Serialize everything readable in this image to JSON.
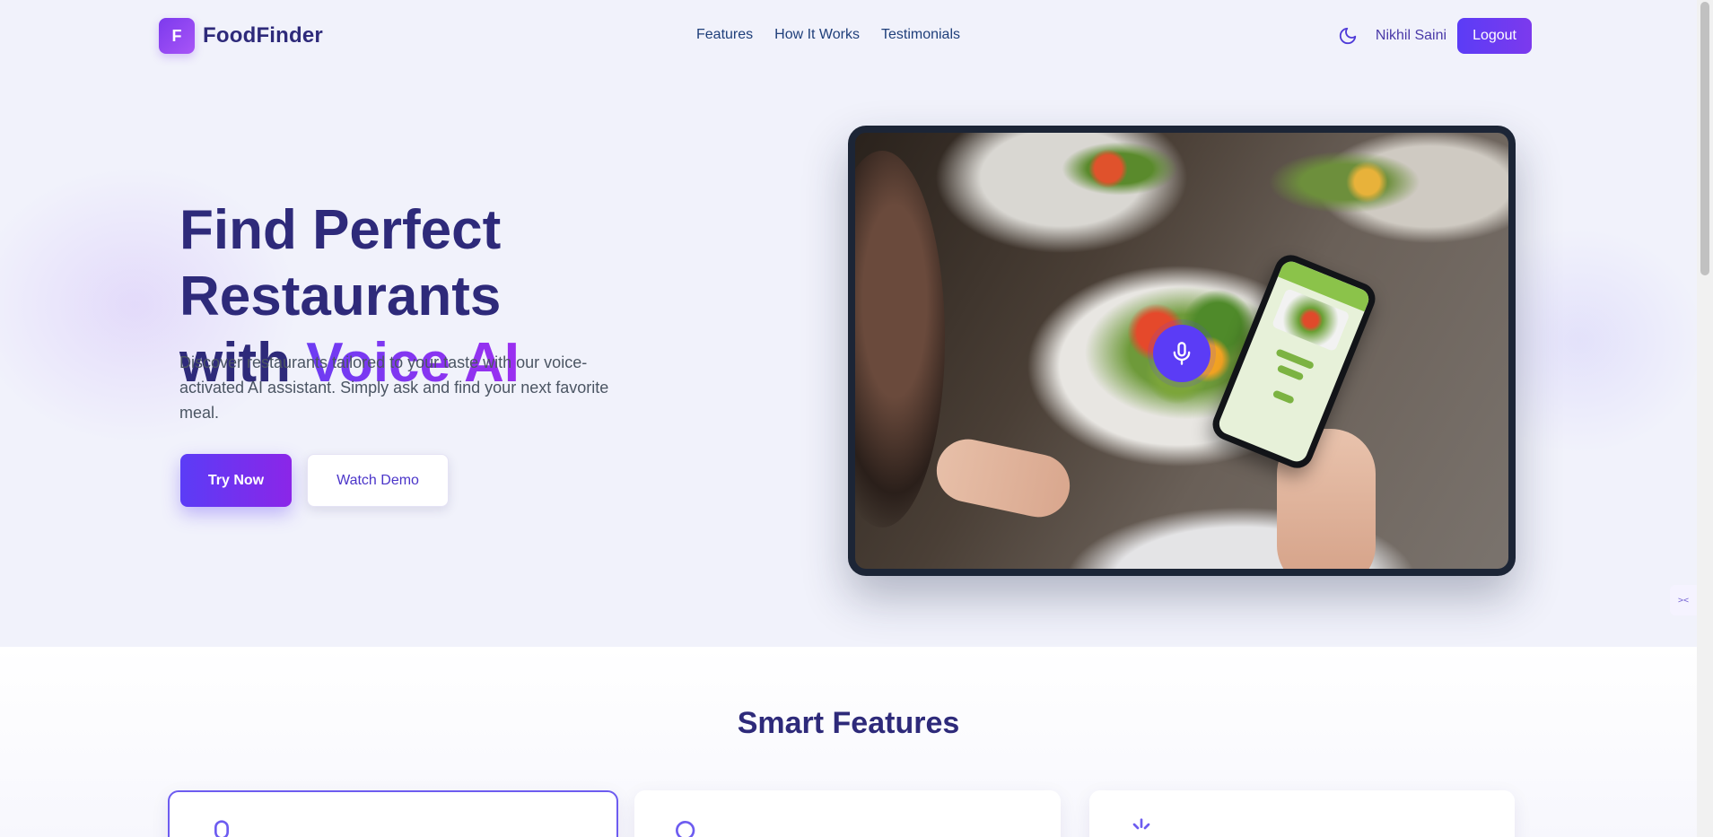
{
  "nav": {
    "brand_mark": "F",
    "brand_name": "FoodFinder",
    "links": [
      "Features",
      "How It Works",
      "Testimonials"
    ],
    "user_name": "Nikhil Saini",
    "logout_label": "Logout",
    "theme_icon": "moon-icon"
  },
  "hero": {
    "title_line1": "Find Perfect Restaurants",
    "title_prefix": "with ",
    "title_accent": "Voice AI",
    "subtitle": "Discover restaurants tailored to your taste with our voice-activated AI assistant. Simply ask and find your next favorite meal.",
    "primary_button": "Try Now",
    "secondary_button": "Watch Demo",
    "image_icon": "microphone-icon"
  },
  "features": {
    "title": "Smart Features"
  },
  "colors": {
    "primary": "#5b3cf6",
    "accent_purple": "#9b2ff0",
    "heading": "#2e2a7a",
    "nav_link": "#1f3f7a",
    "background": "#f1f2fb"
  },
  "side_widget_icon": "collapse-icon",
  "side_widget_text": "><"
}
